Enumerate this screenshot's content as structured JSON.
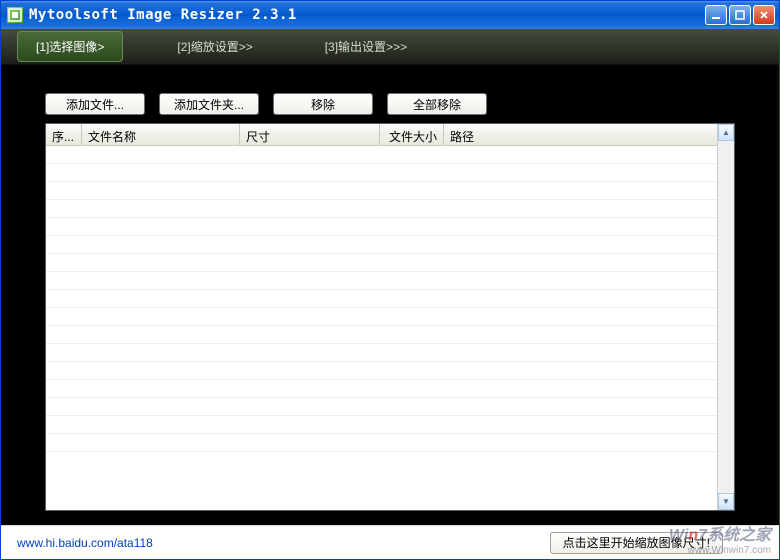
{
  "window": {
    "title": "Mytoolsoft Image Resizer 2.3.1"
  },
  "tabs": {
    "select_images": "[1]选择图像>",
    "resize_settings": "[2]缩放设置>>",
    "output_settings": "[3]输出设置>>>"
  },
  "toolbar": {
    "add_file": "添加文件...",
    "add_folder": "添加文件夹...",
    "remove": "移除",
    "remove_all": "全部移除"
  },
  "columns": {
    "index": "序...",
    "filename": "文件名称",
    "dimensions": "尺寸",
    "filesize": "文件大小",
    "path": "路径"
  },
  "footer": {
    "link": "www.hi.baidu.com/ata118",
    "start_button": "点击这里开始缩放图像尺寸!"
  },
  "watermark": {
    "line1_prefix": "Wi",
    "line1_accent": "n",
    "line1_suffix": "7系统之家",
    "line2": "www.Winwin7.com"
  }
}
